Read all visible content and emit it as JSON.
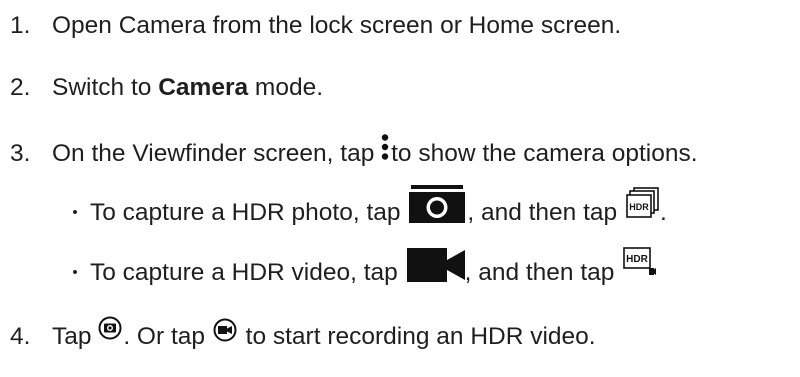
{
  "steps": [
    {
      "number": "1.",
      "text": "Open Camera from the lock screen or Home screen."
    },
    {
      "number": "2.",
      "before": "Switch to ",
      "bold": "Camera",
      "after": " mode."
    },
    {
      "number": "3.",
      "before": "On the Viewfinder screen, tap ",
      "after": "to show the camera options.",
      "icon": "more-options-icon"
    },
    {
      "number": "4.",
      "before": "Tap ",
      "middle": ". Or tap ",
      "after": " to start recording an HDR video.",
      "icons": [
        "shutter-icon",
        "record-icon"
      ]
    }
  ],
  "substeps": [
    {
      "bullet": "•",
      "before": "To capture a HDR photo, tap ",
      "middle": ", and then tap ",
      "after": ".",
      "icons": [
        "photo-mode-icon",
        "hdr-photo-icon"
      ],
      "icon_text": "HDR"
    },
    {
      "bullet": "•",
      "before": "To capture a HDR video, tap ",
      "middle": ", and then tap ",
      "icons": [
        "video-mode-icon",
        "hdr-video-icon"
      ],
      "icon_text": "HDR"
    }
  ]
}
